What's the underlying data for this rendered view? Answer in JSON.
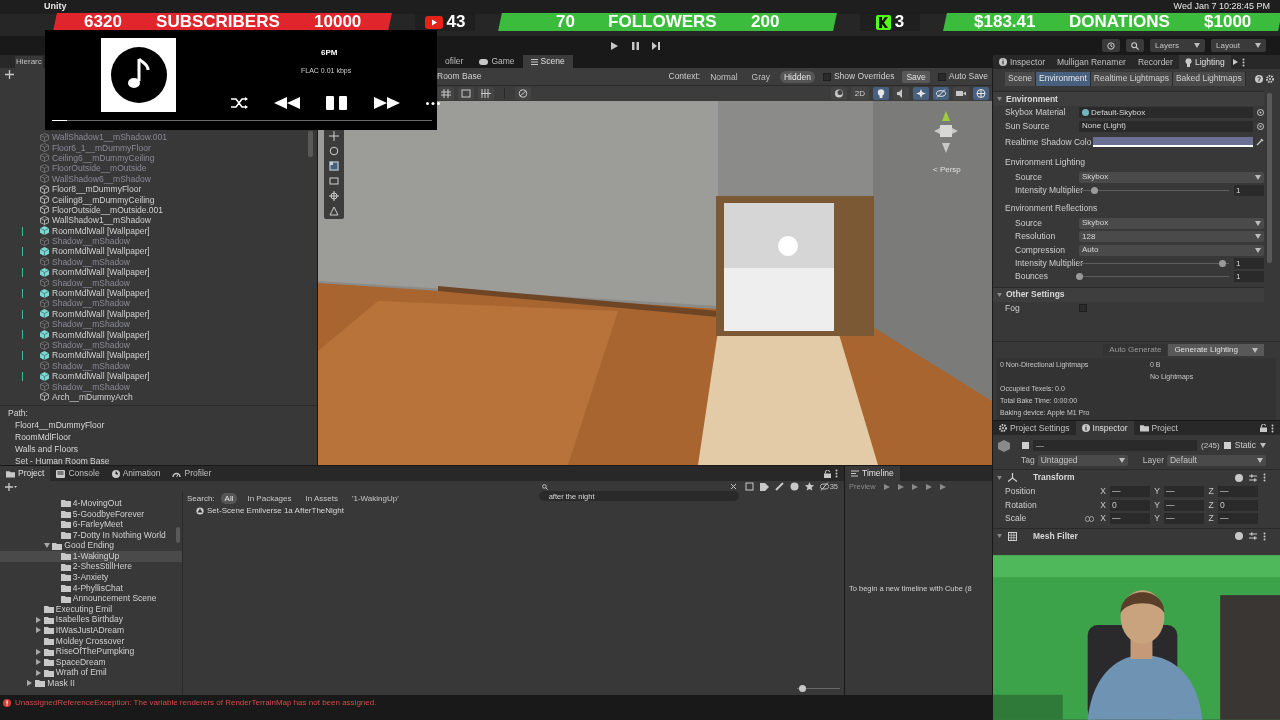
{
  "menu_bar": {
    "app": "Unity",
    "clock": "Wed Jan 7  10:28:45 PM"
  },
  "stream_overlay": {
    "stats": [
      {
        "kind": "goal",
        "value": "6320",
        "label": "SUBSCRIBERS",
        "target": "10000",
        "color": "#e0262c"
      },
      {
        "kind": "video",
        "value": "43"
      },
      {
        "kind": "goal",
        "value": "70",
        "label": "FOLLOWERS",
        "target": "200",
        "color": "#3cbc3c"
      },
      {
        "kind": "logo",
        "value": "3"
      },
      {
        "kind": "goal",
        "value": "$183.41",
        "label": "DONATIONS",
        "target": "$1000",
        "color": "#3cbc3c"
      }
    ]
  },
  "music_player": {
    "time": "6PM",
    "quality": "FLAC 0.01 kbps",
    "level": 0.04
  },
  "toolbar": {
    "layers": "Layers",
    "layout": "Layout"
  },
  "hierarchy": {
    "tab": "Hierarc",
    "items": [
      {
        "name": "WallShadow1__mShadow.001",
        "kind": "mesh",
        "disabled": true
      },
      {
        "name": "Floor6_1__mDummyFloor",
        "kind": "mesh",
        "disabled": true
      },
      {
        "name": "Ceiling6__mDummyCeiling",
        "kind": "mesh",
        "disabled": true
      },
      {
        "name": "FloorOutside__mOutside",
        "kind": "mesh",
        "disabled": true
      },
      {
        "name": "WallShadow6__mShadow",
        "kind": "mesh",
        "disabled": true
      },
      {
        "name": "Floor8__mDummyFloor",
        "kind": "mesh",
        "disabled": false
      },
      {
        "name": "Ceiling8__mDummyCeiling",
        "kind": "mesh",
        "disabled": false
      },
      {
        "name": "FloorOutside__mOutside.001",
        "kind": "mesh",
        "disabled": false
      },
      {
        "name": "WallShadow1__mShadow",
        "kind": "mesh",
        "disabled": false
      },
      {
        "name": "RoomMdlWall [Wallpaper]",
        "kind": "prefab",
        "disabled": false
      },
      {
        "name": "Shadow__mShadow",
        "kind": "mesh",
        "disabled": true
      },
      {
        "name": "RoomMdlWall [Wallpaper]",
        "kind": "prefab",
        "disabled": false
      },
      {
        "name": "Shadow__mShadow",
        "kind": "mesh",
        "disabled": true
      },
      {
        "name": "RoomMdlWall [Wallpaper]",
        "kind": "prefab",
        "disabled": false
      },
      {
        "name": "Shadow__mShadow",
        "kind": "mesh",
        "disabled": true
      },
      {
        "name": "RoomMdlWall [Wallpaper]",
        "kind": "prefab",
        "disabled": false
      },
      {
        "name": "Shadow__mShadow",
        "kind": "mesh",
        "disabled": true
      },
      {
        "name": "RoomMdlWall [Wallpaper]",
        "kind": "prefab",
        "disabled": false
      },
      {
        "name": "Shadow__mShadow",
        "kind": "mesh",
        "disabled": true
      },
      {
        "name": "RoomMdlWall [Wallpaper]",
        "kind": "prefab",
        "disabled": false
      },
      {
        "name": "Shadow__mShadow",
        "kind": "mesh",
        "disabled": true
      },
      {
        "name": "RoomMdlWall [Wallpaper]",
        "kind": "prefab",
        "disabled": false
      },
      {
        "name": "Shadow__mShadow",
        "kind": "mesh",
        "disabled": true
      },
      {
        "name": "RoomMdlWall [Wallpaper]",
        "kind": "prefab",
        "disabled": false
      },
      {
        "name": "Shadow__mShadow",
        "kind": "mesh",
        "disabled": true
      },
      {
        "name": "Arch__mDummyArch",
        "kind": "mesh",
        "disabled": false
      }
    ],
    "path_label": "Path:",
    "path": [
      "Floor4__mDummyFloor",
      "RoomMdlFloor",
      "Walls and Floors",
      "Set - Human Room Base"
    ]
  },
  "scene": {
    "tabs": [
      {
        "label": "ofiler",
        "kind": "profiler",
        "selected": false
      },
      {
        "label": "Game",
        "kind": "game",
        "selected": false
      },
      {
        "label": "Scene",
        "kind": "scene",
        "selected": true
      }
    ],
    "breadcrumb": "Room Base",
    "context_label": "Context:",
    "context_options": [
      {
        "label": "Normal",
        "selected": false
      },
      {
        "label": "Gray",
        "selected": false
      },
      {
        "label": "Hidden",
        "selected": true
      }
    ],
    "show_overrides": {
      "label": "Show Overrides",
      "checked": false
    },
    "save": "Save",
    "auto_save": {
      "label": "Auto Save",
      "checked": false
    },
    "toggle_2d": "2D",
    "persp": "< Persp"
  },
  "lighting": {
    "tabs": [
      {
        "label": "Inspector",
        "kind": "info",
        "selected": false
      },
      {
        "label": "Mulligan Renamer",
        "kind": "plain",
        "selected": false
      },
      {
        "label": "Recorder",
        "kind": "plain",
        "selected": false
      },
      {
        "label": "Lighting",
        "kind": "bulb",
        "selected": true
      }
    ],
    "subtabs": [
      {
        "label": "Scene",
        "selected": false
      },
      {
        "label": "Environment",
        "selected": true
      },
      {
        "label": "Realtime Lightmaps",
        "selected": false
      },
      {
        "label": "Baked Lightmaps",
        "selected": false
      }
    ],
    "sections": [
      {
        "title": "Environment",
        "expanded": true,
        "rows": [
          {
            "kind": "object",
            "label": "Skybox Material",
            "value": "Default-Skybox",
            "icon": true
          },
          {
            "kind": "object",
            "label": "Sun Source",
            "value": "None (Light)",
            "icon": false
          },
          {
            "kind": "color",
            "label": "Realtime Shadow Colo",
            "color": "#6b6f94"
          },
          {
            "kind": "group",
            "label": "Environment Lighting",
            "children": [
              {
                "kind": "dropdown",
                "label": "Source",
                "value": "Skybox"
              },
              {
                "kind": "slider",
                "label": "Intensity Multiplier",
                "level": 0.1,
                "reading": "1"
              }
            ]
          },
          {
            "kind": "group",
            "label": "Environment Reflections",
            "children": [
              {
                "kind": "dropdown",
                "label": "Source",
                "value": "Skybox"
              },
              {
                "kind": "dropdown",
                "label": "Resolution",
                "value": "128"
              },
              {
                "kind": "dropdown",
                "label": "Compression",
                "value": "Auto"
              },
              {
                "kind": "slider",
                "label": "Intensity Multiplier",
                "level": 0.95,
                "reading": "1"
              },
              {
                "kind": "slider",
                "label": "Bounces",
                "level": 0,
                "reading": "1"
              }
            ]
          }
        ]
      },
      {
        "title": "Other Settings",
        "expanded": true,
        "rows": [
          {
            "kind": "checkbox",
            "label": "Fog",
            "checked": false
          }
        ]
      }
    ],
    "auto_generate": {
      "label": "Auto Generate",
      "disabled": true
    },
    "generate": "Generate Lighting",
    "lightmaps": {
      "label": "0 Non-Directional Lightmaps",
      "size": "0 B",
      "note": "No Lightmaps"
    },
    "info": [
      "Occupied Texels: 0.0",
      "Total Bake Time: 0:00:00",
      "Baking device: Apple M1 Pro"
    ]
  },
  "inspector": {
    "tabs": [
      {
        "label": "Project Settings",
        "kind": "gear",
        "selected": false
      },
      {
        "label": "Inspector",
        "kind": "info",
        "selected": true
      },
      {
        "label": "Project",
        "kind": "folder",
        "selected": false
      }
    ],
    "name": "—",
    "count": "(245)",
    "static": "Static",
    "tag_label": "Tag",
    "tag": "Untagged",
    "layer_label": "Layer",
    "layer": "Default",
    "components": [
      {
        "title": "Transform",
        "kind": "transform",
        "expanded": true,
        "fields": [
          {
            "label": "Position",
            "values": [
              {
                "axis": "X",
                "value": "—"
              },
              {
                "axis": "Y",
                "value": "—"
              },
              {
                "axis": "Z",
                "value": "—"
              }
            ],
            "linked": false
          },
          {
            "label": "Rotation",
            "values": [
              {
                "axis": "X",
                "value": "0"
              },
              {
                "axis": "Y",
                "value": "—"
              },
              {
                "axis": "Z",
                "value": "0"
              }
            ],
            "linked": false
          },
          {
            "label": "Scale",
            "values": [
              {
                "axis": "X",
                "value": "—"
              },
              {
                "axis": "Y",
                "value": "—"
              },
              {
                "axis": "Z",
                "value": "—"
              }
            ],
            "linked": true
          }
        ]
      },
      {
        "title": "Mesh Filter",
        "kind": "mesh",
        "expanded": true
      }
    ]
  },
  "project": {
    "tabs": [
      {
        "label": "Project",
        "kind": "folder",
        "selected": true
      },
      {
        "label": "Console",
        "kind": "console",
        "selected": false
      },
      {
        "label": "Animation",
        "kind": "animation",
        "selected": false
      },
      {
        "label": "Profiler",
        "kind": "profiler",
        "selected": false
      }
    ],
    "search": "after the night",
    "hidden_count": "35",
    "filter_label": "Search:",
    "filters": [
      {
        "label": "All",
        "selected": true
      },
      {
        "label": "In Packages",
        "selected": false
      },
      {
        "label": "In Assets",
        "selected": false
      },
      {
        "label": "'1-WakingUp'",
        "selected": false
      }
    ],
    "results": [
      "Set-Scene Emilverse 1a AfterTheNight"
    ],
    "tree": [
      {
        "children": [
          {
            "children": [
              {
                "children": [
                  {
                    "label": "4-MovingOut",
                    "kind": "leaf",
                    "selected": false
                  },
                  {
                    "label": "5-GoodbyeForever",
                    "kind": "leaf",
                    "selected": false
                  },
                  {
                    "label": "6-FarleyMeet",
                    "kind": "leaf",
                    "selected": false
                  },
                  {
                    "label": "7-Dotty In Nothing World",
                    "kind": "leaf",
                    "selected": false
                  }
                ]
              },
              {
                "label": "Good Ending",
                "kind": "branch",
                "expanded": true,
                "selected": false,
                "children": [
                  {
                    "label": "1-WakingUp",
                    "kind": "leaf",
                    "selected": true
                  },
                  {
                    "label": "2-ShesStillHere",
                    "kind": "leaf",
                    "selected": false
                  },
                  {
                    "label": "3-Anxiety",
                    "kind": "leaf",
                    "selected": false
                  },
                  {
                    "label": "4-PhyllisChat",
                    "kind": "leaf",
                    "selected": false
                  },
                  {
                    "label": "Announcement Scene",
                    "kind": "leaf",
                    "selected": false
                  }
                ]
              }
            ]
          },
          {
            "label": "Executing Emil",
            "kind": "leaf",
            "selected": false
          },
          {
            "label": "Isabelles Birthday",
            "kind": "branch",
            "expanded": false,
            "selected": false
          },
          {
            "label": "ItWasJustADream",
            "kind": "branch",
            "expanded": false,
            "selected": false
          },
          {
            "label": "Moldey Crossover",
            "kind": "leaf",
            "selected": false
          },
          {
            "label": "RiseOfThePumpking",
            "kind": "branch",
            "expanded": false,
            "selected": false
          },
          {
            "label": "SpaceDream",
            "kind": "branch",
            "expanded": false,
            "selected": false
          },
          {
            "label": "Wrath of Emil",
            "kind": "branch",
            "expanded": false,
            "selected": false
          }
        ]
      },
      {
        "label": "Mask II",
        "kind": "branch",
        "expanded": false,
        "selected": false
      }
    ],
    "zoom": {
      "level": 0.05
    }
  },
  "timeline": {
    "title": "Timeline",
    "preview": "Preview",
    "message": "To begin a new timeline with Cube (8"
  },
  "status_bar": {
    "message": "UnassignedReferenceException: The variable renderers of RenderTerrainMap has not been assigned."
  }
}
